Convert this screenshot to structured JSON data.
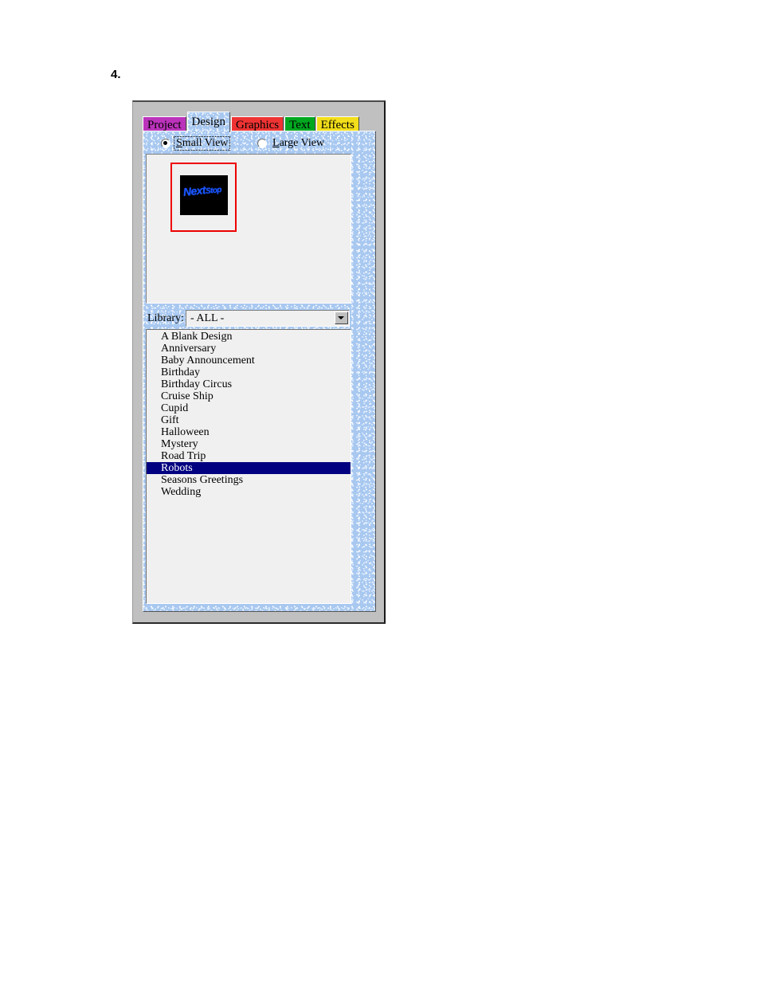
{
  "document": {
    "step_marker": "4."
  },
  "window": {
    "tabs": [
      {
        "label": "Project",
        "color": "#bb33bb",
        "active": false
      },
      {
        "label": "Design",
        "color": "#a8c8f0",
        "active": true
      },
      {
        "label": "Graphics",
        "color": "#ee3333",
        "active": false
      },
      {
        "label": "Text",
        "color": "#00a820",
        "active": false
      },
      {
        "label": "Effects",
        "color": "#f2de1a",
        "active": false
      }
    ]
  },
  "design_tab": {
    "view_options": {
      "small_view": {
        "label": "Small View",
        "accel": "S",
        "selected": true,
        "focused": true
      },
      "large_view": {
        "label": "Large View",
        "accel": "L",
        "selected": false,
        "focused": false
      }
    },
    "preview": {
      "selection_color": "#ee0000",
      "thumbnail": {
        "title_main": "Next",
        "title_sub": "Stop",
        "text_color": "#1a55ff",
        "background_color": "#000000",
        "selected": true
      }
    },
    "library": {
      "label": "Library:",
      "selected_value": "- ALL -",
      "dropdown_icon": "chevron-down-icon"
    },
    "design_list": {
      "selected_index": 11,
      "selection_color": "#000080",
      "items": [
        "A Blank Design",
        "Anniversary",
        "Baby Announcement",
        "Birthday",
        "Birthday Circus",
        "Cruise Ship",
        "Cupid",
        "Gift",
        "Halloween",
        "Mystery",
        "Road Trip",
        "Robots",
        "Seasons Greetings",
        "Wedding"
      ]
    }
  }
}
